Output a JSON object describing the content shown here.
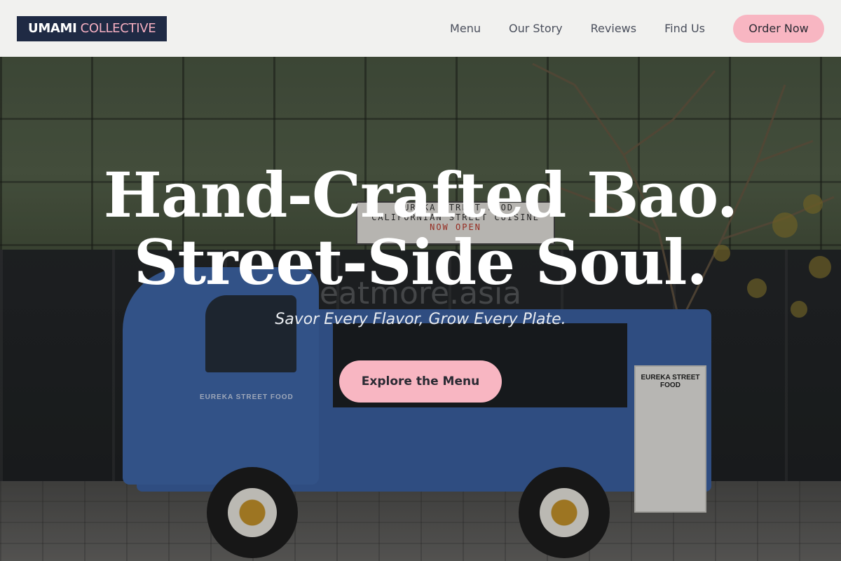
{
  "brand": {
    "name_primary": "UMAMI",
    "name_secondary": "COLLECTIVE",
    "colors": {
      "navy": "#1f2a44",
      "pink": "#f8b6c2",
      "pink_text": "#f4aec0"
    }
  },
  "nav": {
    "items": [
      {
        "label": "Menu"
      },
      {
        "label": "Our Story"
      },
      {
        "label": "Reviews"
      },
      {
        "label": "Find Us"
      }
    ],
    "cta_label": "Order Now"
  },
  "hero": {
    "headline_line1": "Hand-Crafted Bao.",
    "headline_line2": "Street-Side Soul.",
    "tagline": "Savor Every Flavor, Grow Every Plate.",
    "cta_label": "Explore the Menu",
    "watermark": "eatmore.asia",
    "background_image": "food-truck-photo",
    "scene_text": {
      "shop_sign_line1": "EUREKA STREET FOOD",
      "shop_sign_line2": "CALIFORNIAN STREET CUISINE",
      "shop_sign_line3": "NOW OPEN",
      "truck_side": "EUREKA STREET FOOD",
      "menu_board_title": "EUREKA STREET FOOD"
    }
  }
}
